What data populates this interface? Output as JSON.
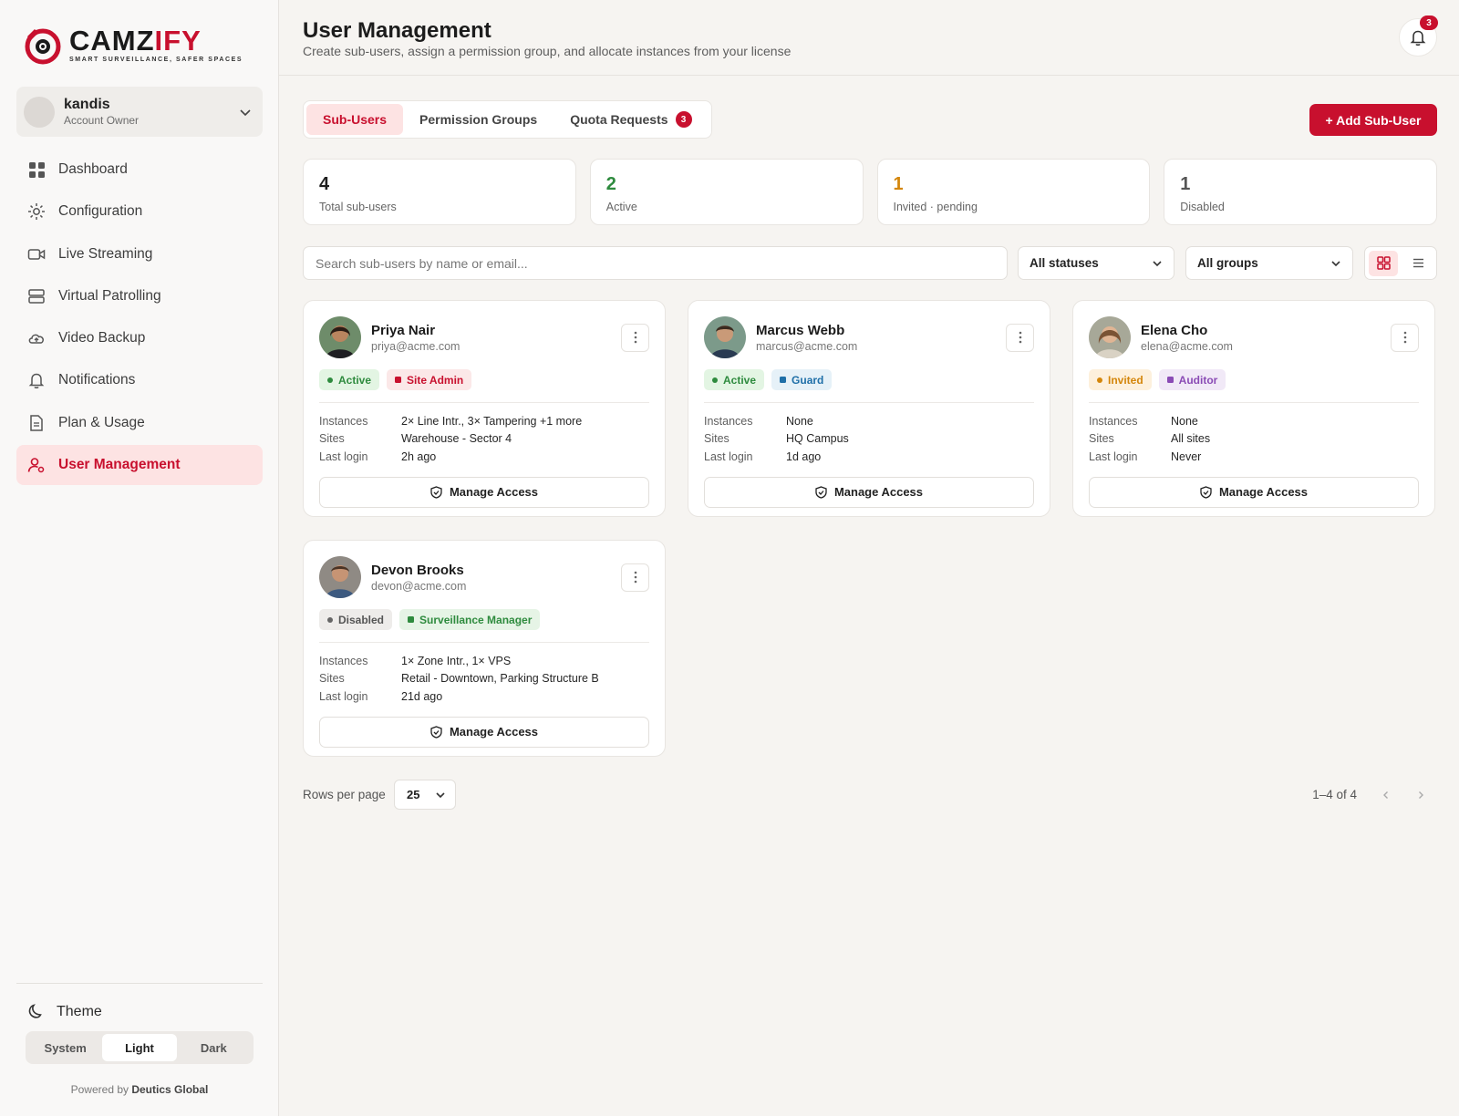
{
  "brand": {
    "name_part1": "CAMZ",
    "name_part2": "IFY",
    "tagline": "SMART SURVEILLANCE, SAFER SPACES",
    "accent": "#c8102e"
  },
  "account": {
    "name": "kandis",
    "role": "Account Owner"
  },
  "nav": [
    {
      "label": "Dashboard",
      "icon": "grid-icon"
    },
    {
      "label": "Configuration",
      "icon": "gear-icon"
    },
    {
      "label": "Live Streaming",
      "icon": "video-camera-icon"
    },
    {
      "label": "Virtual Patrolling",
      "icon": "server-icon"
    },
    {
      "label": "Video Backup",
      "icon": "cloud-upload-icon"
    },
    {
      "label": "Notifications",
      "icon": "bell-icon"
    },
    {
      "label": "Plan & Usage",
      "icon": "document-icon"
    },
    {
      "label": "User Management",
      "icon": "user-gear-icon",
      "active": true
    }
  ],
  "theme": {
    "label": "Theme",
    "options": [
      "System",
      "Light",
      "Dark"
    ],
    "selected": "Light"
  },
  "footer": {
    "powered_prefix": "Powered by",
    "powered_brand": "Deutics Global"
  },
  "header": {
    "title": "User Management",
    "subtitle": "Create sub-users, assign a permission group, and allocate instances from your license",
    "notification_count": "3"
  },
  "tabs": [
    {
      "label": "Sub-Users",
      "active": true
    },
    {
      "label": "Permission Groups"
    },
    {
      "label": "Quota Requests",
      "badge": "3"
    }
  ],
  "add_button": "+ Add Sub-User",
  "stats": [
    {
      "value": "4",
      "label": "Total sub-users",
      "color": "#1c1c1c"
    },
    {
      "value": "2",
      "label": "Active",
      "color": "#2e8b3e"
    },
    {
      "value": "1",
      "label": "Invited · pending",
      "color": "#d4860b"
    },
    {
      "value": "1",
      "label": "Disabled",
      "color": "#555555"
    }
  ],
  "filters": {
    "search_placeholder": "Search sub-users by name or email...",
    "status_value": "All statuses",
    "group_value": "All groups"
  },
  "field_labels": {
    "instances": "Instances",
    "sites": "Sites",
    "last_login": "Last login",
    "manage": "Manage Access"
  },
  "users": [
    {
      "name": "Priya Nair",
      "email": "priya@acme.com",
      "status": "Active",
      "group": "Site Admin",
      "instances": "2× Line Intr., 3× Tampering +1 more",
      "sites": "Warehouse - Sector 4",
      "last_login": "2h ago"
    },
    {
      "name": "Marcus Webb",
      "email": "marcus@acme.com",
      "status": "Active",
      "group": "Guard",
      "instances": "None",
      "sites": "HQ Campus",
      "last_login": "1d ago"
    },
    {
      "name": "Elena Cho",
      "email": "elena@acme.com",
      "status": "Invited",
      "group": "Auditor",
      "instances": "None",
      "sites": "All sites",
      "last_login": "Never"
    },
    {
      "name": "Devon Brooks",
      "email": "devon@acme.com",
      "status": "Disabled",
      "group": "Surveillance Manager",
      "instances": "1× Zone Intr., 1× VPS",
      "sites": "Retail - Downtown, Parking Structure B",
      "last_login": "21d ago"
    }
  ],
  "pagination": {
    "rows_label": "Rows per page",
    "rows_value": "25",
    "range": "1–4 of 4"
  }
}
